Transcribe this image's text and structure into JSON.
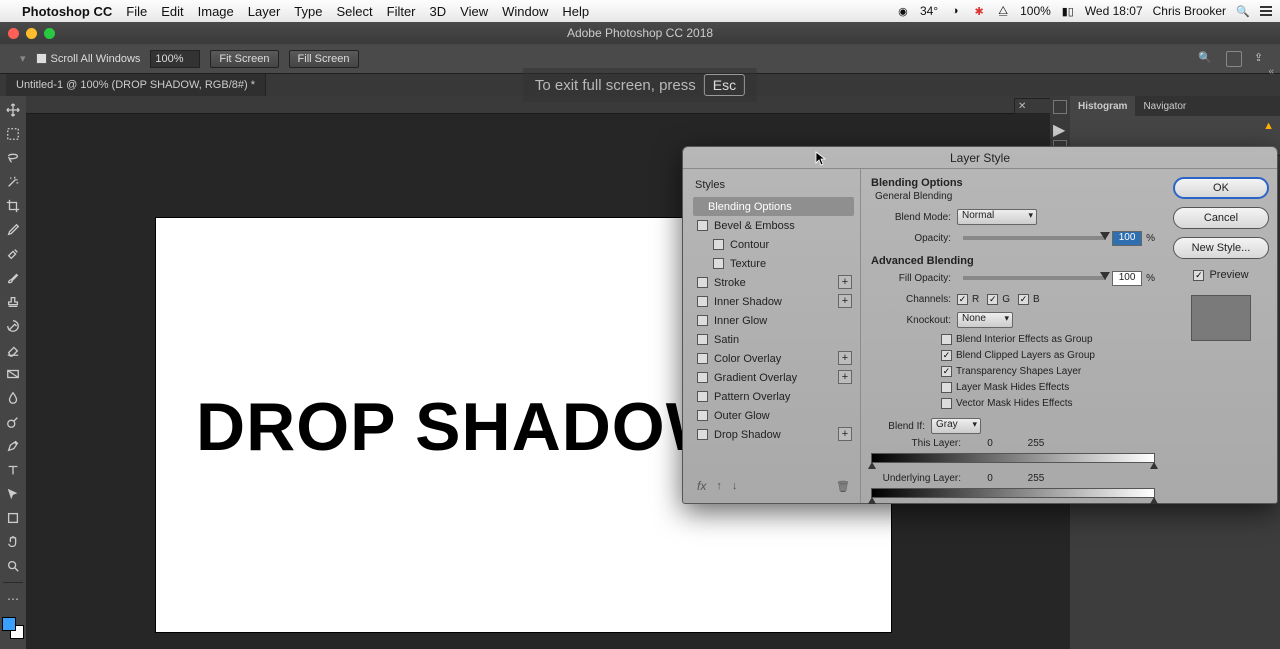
{
  "menubar": {
    "app": "Photoshop CC",
    "items": [
      "File",
      "Edit",
      "Image",
      "Layer",
      "Type",
      "Select",
      "Filter",
      "3D",
      "View",
      "Window",
      "Help"
    ],
    "status_temp": "34°",
    "status_batt": "100%",
    "status_time": "Wed 18:07",
    "status_user": "Chris Brooker"
  },
  "window": {
    "title": "Adobe Photoshop CC 2018"
  },
  "options": {
    "scroll_all": "Scroll All Windows",
    "zoom": "100%",
    "fit": "Fit Screen",
    "fill": "Fill Screen"
  },
  "doc_tab": "Untitled-1 @ 100% (DROP SHADOW, RGB/8#) *",
  "fs_hint": {
    "text": "To exit full screen, press",
    "key": "Esc"
  },
  "canvas_text": "DROP SHADOW",
  "right_panels": {
    "tab_a": "Histogram",
    "tab_b": "Navigator"
  },
  "dialog": {
    "title": "Layer Style",
    "styles_head": "Styles",
    "rows": {
      "blending": "Blending Options",
      "bevel": "Bevel & Emboss",
      "contour": "Contour",
      "texture": "Texture",
      "stroke": "Stroke",
      "inner_shadow": "Inner Shadow",
      "inner_glow": "Inner Glow",
      "satin": "Satin",
      "color_overlay": "Color Overlay",
      "gradient_overlay": "Gradient Overlay",
      "pattern_overlay": "Pattern Overlay",
      "outer_glow": "Outer Glow",
      "drop_shadow": "Drop Shadow"
    },
    "main": {
      "head": "Blending Options",
      "sub": "General Blending",
      "blend_mode_label": "Blend Mode:",
      "blend_mode_value": "Normal",
      "opacity_label": "Opacity:",
      "opacity_value": "100",
      "pct": "%",
      "adv_head": "Advanced Blending",
      "fill_label": "Fill Opacity:",
      "fill_value": "100",
      "channels_label": "Channels:",
      "ch_r": "R",
      "ch_g": "G",
      "ch_b": "B",
      "knockout_label": "Knockout:",
      "knockout_value": "None",
      "adv1": "Blend Interior Effects as Group",
      "adv2": "Blend Clipped Layers as Group",
      "adv3": "Transparency Shapes Layer",
      "adv4": "Layer Mask Hides Effects",
      "adv5": "Vector Mask Hides Effects",
      "blendif_label": "Blend If:",
      "blendif_value": "Gray",
      "this_layer": "This Layer:",
      "under_layer": "Underlying Layer:",
      "v0": "0",
      "v255": "255"
    },
    "buttons": {
      "ok": "OK",
      "cancel": "Cancel",
      "newstyle": "New Style...",
      "preview": "Preview"
    }
  }
}
